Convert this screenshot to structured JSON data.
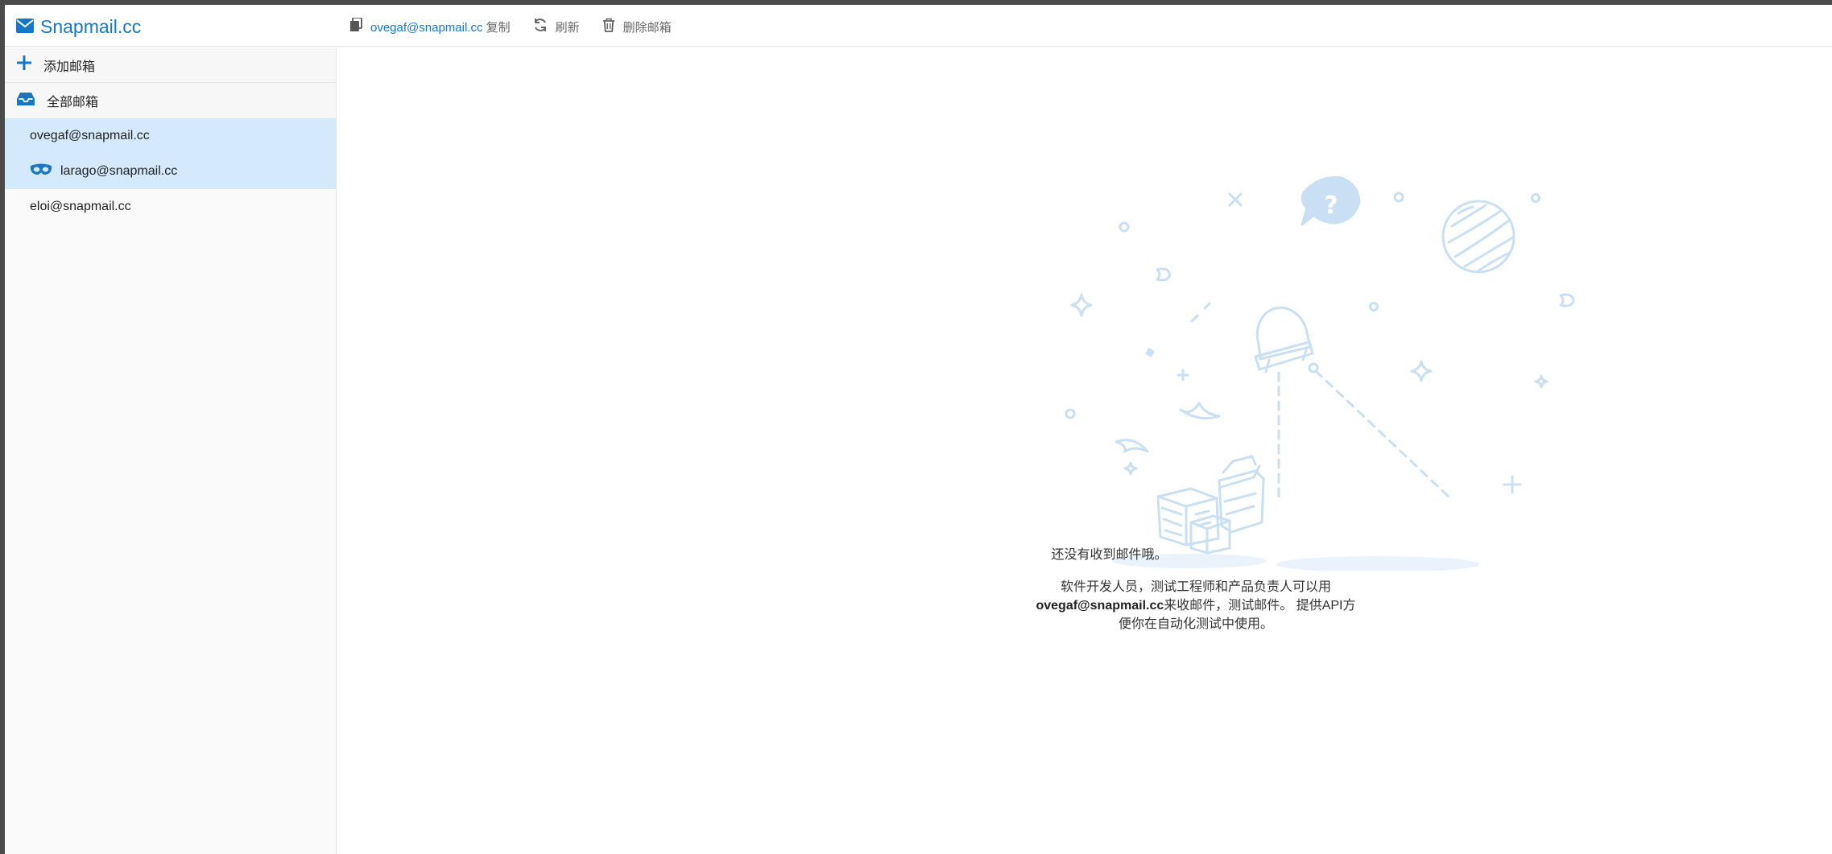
{
  "app": {
    "brand": "Snapmail.cc"
  },
  "toolbar": {
    "current_address": "ovegaf@snapmail.cc",
    "copy_label": "复制",
    "refresh_label": "刷新",
    "delete_label": "删除邮箱"
  },
  "sidebar": {
    "add_label": "添加邮箱",
    "all_label": "全部邮箱",
    "mailboxes": [
      {
        "address": "ovegaf@snapmail.cc",
        "selected": true
      },
      {
        "address": "larago@snapmail.cc",
        "selected": true,
        "icon": "mask-icon"
      },
      {
        "address": "eloi@snapmail.cc",
        "selected": false
      }
    ]
  },
  "empty_state": {
    "title": "还没有收到邮件哦。",
    "line1": "软件开发人员，测试工程师和产品负责人可以用",
    "address": "ovegaf@snapmail.cc",
    "line2_suffix": "来收邮件，测试邮件。 提供API方",
    "line3": "便你在自动化测试中使用。"
  },
  "colors": {
    "accent": "#1677c8",
    "selected_bg": "#d4e9fc",
    "illustration": "#c9dff3"
  }
}
